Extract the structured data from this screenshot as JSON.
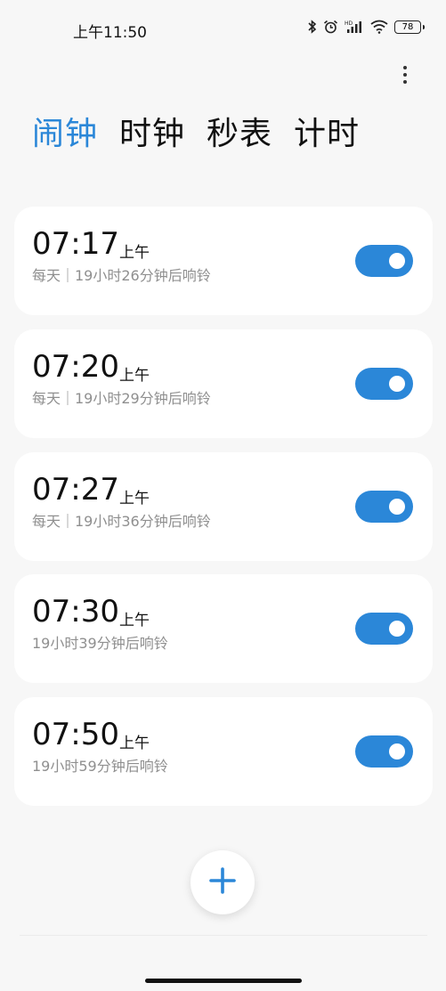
{
  "status_bar": {
    "time": "上午11:50",
    "battery": "78",
    "icons": [
      "bluetooth-icon",
      "alarm-icon",
      "hd-signal-icon",
      "wifi-icon",
      "battery-icon"
    ]
  },
  "toolbar": {
    "more_icon": "more-vertical-icon"
  },
  "tabs": [
    {
      "label": "闹钟",
      "active": true
    },
    {
      "label": "时钟",
      "active": false
    },
    {
      "label": "秒表",
      "active": false
    },
    {
      "label": "计时",
      "active": false
    }
  ],
  "alarms": [
    {
      "time": "07:17",
      "ampm": "上午",
      "subtitle": "每天｜19小时26分钟后响铃",
      "enabled": true
    },
    {
      "time": "07:20",
      "ampm": "上午",
      "subtitle": "每天｜19小时29分钟后响铃",
      "enabled": true
    },
    {
      "time": "07:27",
      "ampm": "上午",
      "subtitle": "每天｜19小时36分钟后响铃",
      "enabled": true
    },
    {
      "time": "07:30",
      "ampm": "上午",
      "subtitle": "19小时39分钟后响铃",
      "enabled": true
    },
    {
      "time": "07:50",
      "ampm": "上午",
      "subtitle": "19小时59分钟后响铃",
      "enabled": true
    }
  ],
  "fab": {
    "icon": "plus-icon"
  },
  "colors": {
    "accent": "#2b87d8",
    "background": "#f7f7f7",
    "card": "#ffffff",
    "secondary_text": "#8f8f8f"
  }
}
